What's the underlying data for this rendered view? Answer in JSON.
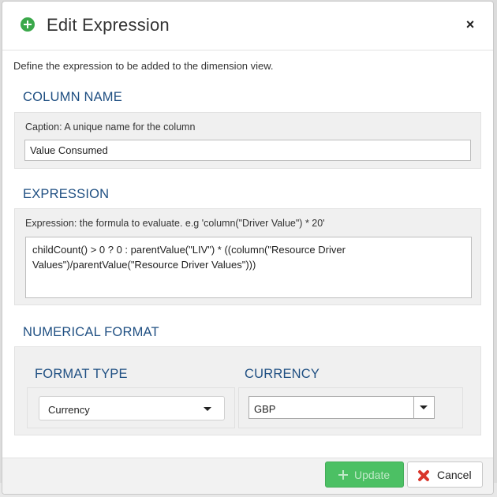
{
  "dialog": {
    "title": "Edit Expression",
    "title_icon": "plus-circle-icon",
    "close_glyph": "×",
    "intro": "Define the expression to be added to the dimension view."
  },
  "column_name": {
    "heading": "COLUMN NAME",
    "caption_label": "Caption: A unique name for the column",
    "caption_value": "Value Consumed"
  },
  "expression": {
    "heading": "EXPRESSION",
    "label": "Expression: the formula to evaluate. e.g 'column(\"Driver Value\") * 20'",
    "value": "childCount() > 0 ? 0 : parentValue(\"LIV\") * ((column(\"Resource Driver Values\")/parentValue(\"Resource Driver Values\")))"
  },
  "numerical_format": {
    "heading": "NUMERICAL FORMAT",
    "format_type": {
      "heading": "FORMAT TYPE",
      "selected": "Currency"
    },
    "currency": {
      "heading": "CURRENCY",
      "selected": "GBP"
    }
  },
  "footer": {
    "update_label": "Update",
    "cancel_label": "Cancel"
  },
  "colors": {
    "heading": "#1f4f82",
    "update_button": "#4cc064",
    "cancel_icon": "#d9362b",
    "title_icon": "#3aa84a"
  }
}
